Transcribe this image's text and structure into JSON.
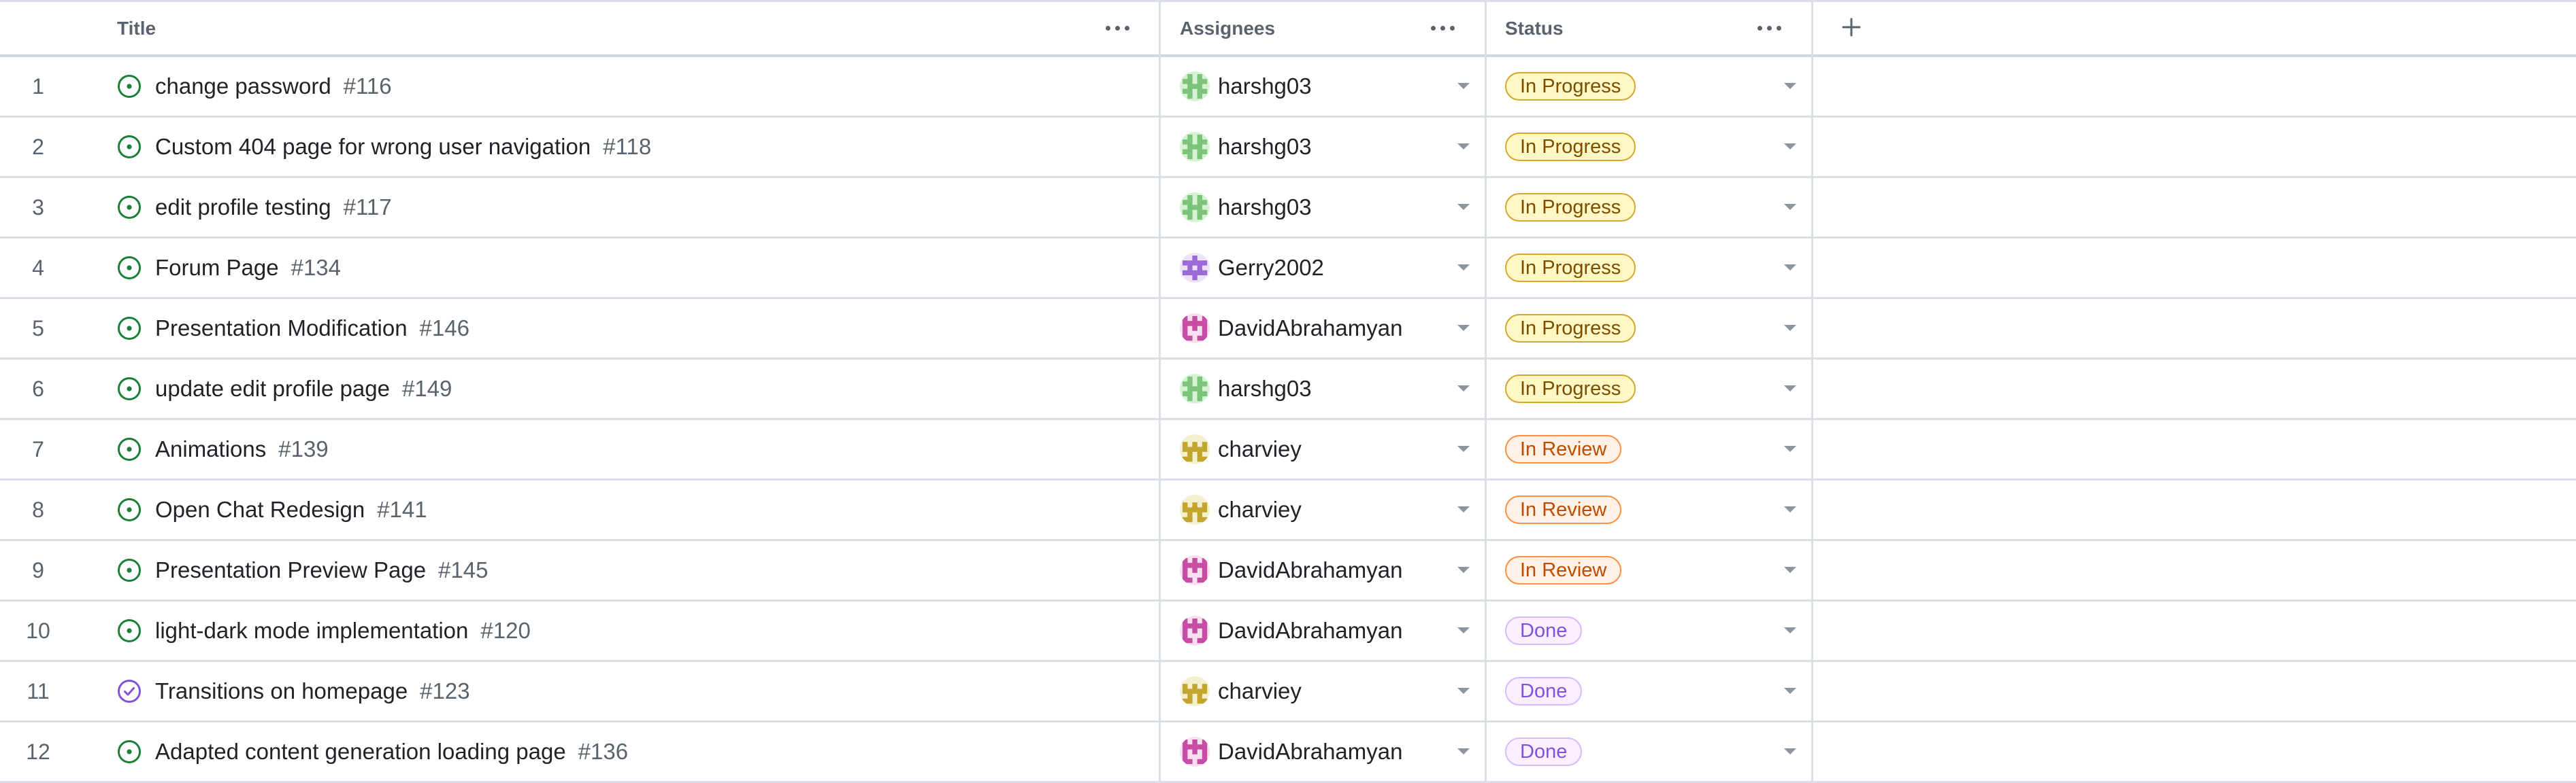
{
  "columns": {
    "title": "Title",
    "assignees": "Assignees",
    "status": "Status"
  },
  "status_styles": {
    "In Progress": {
      "bg": "#fff8c5",
      "border": "#d4a72c",
      "color": "#7d4e00"
    },
    "In Review": {
      "bg": "#fff1e5",
      "border": "#fb8f44",
      "color": "#bc4c00"
    },
    "Done": {
      "bg": "#fbefff",
      "border": "#d8b9ff",
      "color": "#8250df"
    }
  },
  "issue_icon_colors": {
    "open": "#1a7f37",
    "closed": "#8250df"
  },
  "avatars": {
    "harshg03": "green-identicon",
    "Gerry2002": "purple-identicon",
    "DavidAbrahamyan": "pink-identicon",
    "charviey": "yellow-identicon"
  },
  "rows": [
    {
      "num": "1",
      "title": "change password",
      "issue": "#116",
      "state": "open",
      "assignee": "harshg03",
      "status": "In Progress"
    },
    {
      "num": "2",
      "title": "Custom 404 page for wrong user navigation",
      "issue": "#118",
      "state": "open",
      "assignee": "harshg03",
      "status": "In Progress"
    },
    {
      "num": "3",
      "title": "edit profile testing",
      "issue": "#117",
      "state": "open",
      "assignee": "harshg03",
      "status": "In Progress"
    },
    {
      "num": "4",
      "title": "Forum Page",
      "issue": "#134",
      "state": "open",
      "assignee": "Gerry2002",
      "status": "In Progress"
    },
    {
      "num": "5",
      "title": "Presentation Modification",
      "issue": "#146",
      "state": "open",
      "assignee": "DavidAbrahamyan",
      "status": "In Progress"
    },
    {
      "num": "6",
      "title": "update edit profile page",
      "issue": "#149",
      "state": "open",
      "assignee": "harshg03",
      "status": "In Progress"
    },
    {
      "num": "7",
      "title": "Animations",
      "issue": "#139",
      "state": "open",
      "assignee": "charviey",
      "status": "In Review"
    },
    {
      "num": "8",
      "title": "Open Chat Redesign",
      "issue": "#141",
      "state": "open",
      "assignee": "charviey",
      "status": "In Review"
    },
    {
      "num": "9",
      "title": "Presentation Preview Page",
      "issue": "#145",
      "state": "open",
      "assignee": "DavidAbrahamyan",
      "status": "In Review"
    },
    {
      "num": "10",
      "title": "light-dark mode implementation",
      "issue": "#120",
      "state": "open",
      "assignee": "DavidAbrahamyan",
      "status": "Done"
    },
    {
      "num": "11",
      "title": "Transitions on homepage",
      "issue": "#123",
      "state": "closed",
      "assignee": "charviey",
      "status": "Done"
    },
    {
      "num": "12",
      "title": "Adapted content generation loading page",
      "issue": "#136",
      "state": "open",
      "assignee": "DavidAbrahamyan",
      "status": "Done"
    }
  ]
}
